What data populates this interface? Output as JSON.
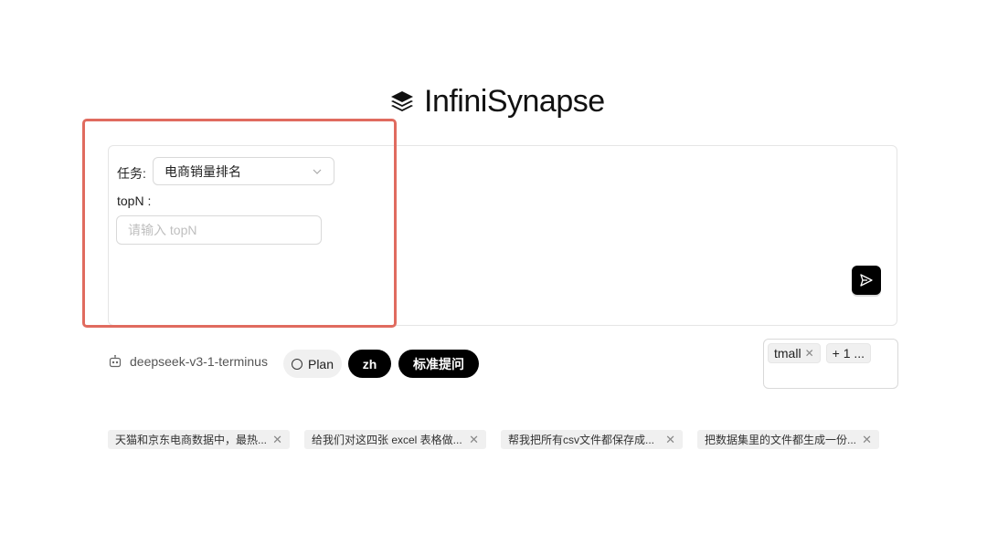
{
  "brand": {
    "name": "InfiniSynapse",
    "icon": "layers-icon"
  },
  "form": {
    "task_label": "任务:",
    "task_value": "电商销量排名",
    "topn_label": "topN :",
    "topn_placeholder": "请输入 topN",
    "topn_value": ""
  },
  "toolbar": {
    "model_name": "deepseek-v3-1-terminus",
    "plan_label": "Plan",
    "lang_label": "zh",
    "mode_label": "标准提问"
  },
  "datasources": {
    "tags": [
      {
        "label": "tmall",
        "removable": true
      },
      {
        "label": "+ 1 ...",
        "removable": false
      }
    ]
  },
  "suggestions": [
    "天猫和京东电商数据中，最热...",
    "给我们对这四张 excel 表格做...",
    "帮我把所有csv文件都保存成...",
    "把数据集里的文件都生成一份..."
  ],
  "colors": {
    "highlight": "#e06b5f",
    "primary": "#000000"
  }
}
